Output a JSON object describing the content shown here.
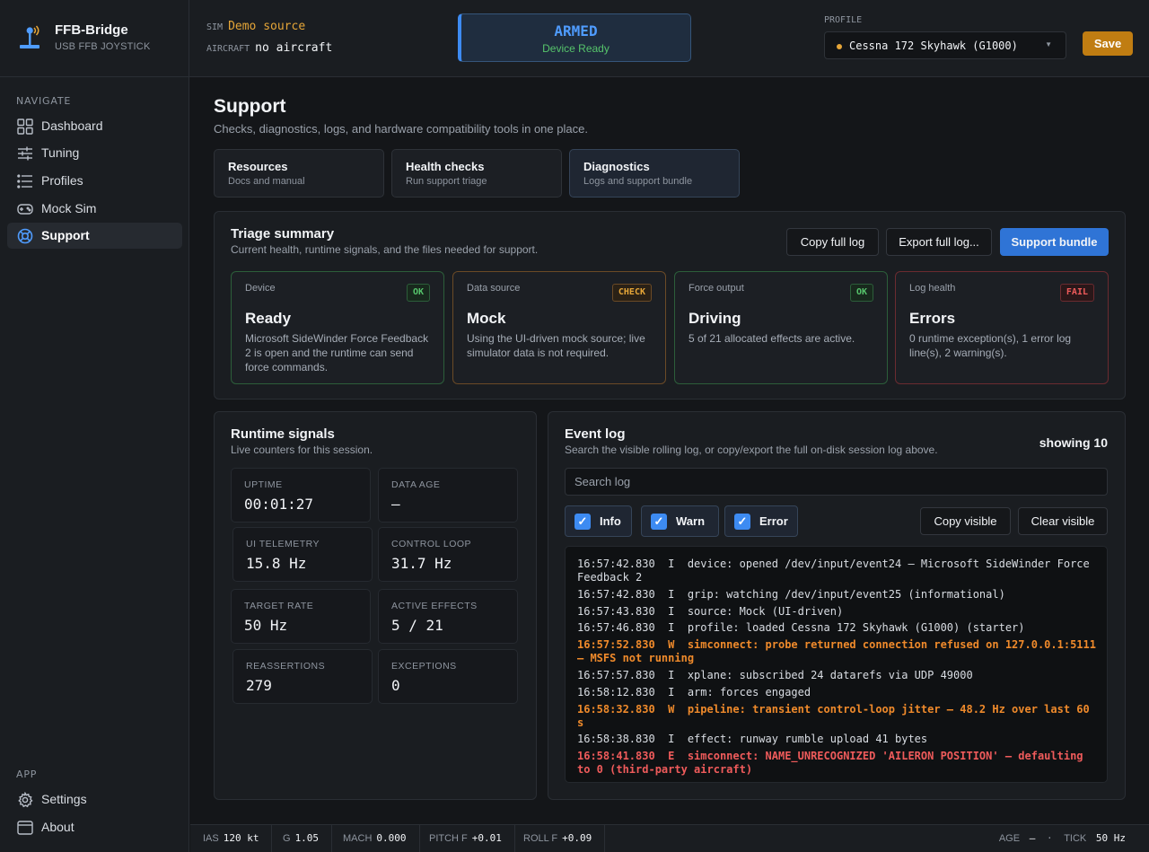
{
  "app": {
    "name": "FFB-Bridge",
    "subtitle": "USB FFB JOYSTICK"
  },
  "sim": {
    "sim_label": "SIM",
    "sim_value": "Demo source",
    "aircraft_label": "AIRCRAFT",
    "aircraft_value": "no aircraft"
  },
  "status": {
    "state": "ARMED",
    "detail": "Device Ready"
  },
  "profile": {
    "label": "PROFILE",
    "selected": "Cessna 172 Skyhawk (G1000)",
    "save_label": "Save"
  },
  "sidebar": {
    "navigate_heading": "NAVIGATE",
    "items": [
      {
        "label": "Dashboard",
        "icon": "dashboard-icon"
      },
      {
        "label": "Tuning",
        "icon": "sliders-icon"
      },
      {
        "label": "Profiles",
        "icon": "list-icon"
      },
      {
        "label": "Mock Sim",
        "icon": "gamepad-icon"
      },
      {
        "label": "Support",
        "icon": "lifebuoy-icon"
      }
    ],
    "app_heading": "APP",
    "app_items": [
      {
        "label": "Settings",
        "icon": "gear-icon"
      },
      {
        "label": "About",
        "icon": "window-icon"
      }
    ]
  },
  "page": {
    "title": "Support",
    "subtitle": "Checks, diagnostics, logs, and hardware compatibility tools in one place.",
    "tabs": [
      {
        "title": "Resources",
        "sub": "Docs and manual"
      },
      {
        "title": "Health checks",
        "sub": "Run support triage"
      },
      {
        "title": "Diagnostics",
        "sub": "Logs and support bundle"
      }
    ]
  },
  "triage": {
    "title": "Triage summary",
    "subtitle": "Current health, runtime signals, and the files needed for support.",
    "copy_label": "Copy full log",
    "export_label": "Export full log...",
    "bundle_label": "Support bundle",
    "cards": [
      {
        "label": "Device",
        "badge": "OK",
        "value": "Ready",
        "desc": "Microsoft SideWinder Force Feedback 2 is open and the runtime can send force commands."
      },
      {
        "label": "Data source",
        "badge": "CHECK",
        "value": "Mock",
        "desc": "Using the UI-driven mock source; live simulator data is not required."
      },
      {
        "label": "Force output",
        "badge": "OK",
        "value": "Driving",
        "desc": "5 of 21 allocated effects are active."
      },
      {
        "label": "Log health",
        "badge": "FAIL",
        "value": "Errors",
        "desc": "0 runtime exception(s), 1 error log line(s), 2 warning(s)."
      }
    ]
  },
  "runtime": {
    "title": "Runtime signals",
    "subtitle": "Live counters for this session.",
    "signals": [
      {
        "label": "UPTIME",
        "value": "00:01:27"
      },
      {
        "label": "DATA AGE",
        "value": "—"
      },
      {
        "label": "UI TELEMETRY",
        "value": "15.8 Hz"
      },
      {
        "label": "CONTROL LOOP",
        "value": "31.7 Hz"
      },
      {
        "label": "TARGET RATE",
        "value": "50 Hz"
      },
      {
        "label": "ACTIVE EFFECTS",
        "value": "5 / 21"
      },
      {
        "label": "REASSERTIONS",
        "value": "279"
      },
      {
        "label": "EXCEPTIONS",
        "value": "0"
      }
    ]
  },
  "eventlog": {
    "title": "Event log",
    "subtitle": "Search the visible rolling log, or copy/export the full on-disk session log above.",
    "count": "showing 10",
    "search_placeholder": "Search log",
    "filters": [
      {
        "label": "Info"
      },
      {
        "label": "Warn"
      },
      {
        "label": "Error"
      }
    ],
    "copy_visible_label": "Copy visible",
    "clear_visible_label": "Clear visible",
    "lines": [
      {
        "level": "I",
        "text": "16:57:42.830  I  device: opened /dev/input/event24 — Microsoft SideWinder Force Feedback 2"
      },
      {
        "level": "I",
        "text": "16:57:42.830  I  grip: watching /dev/input/event25 (informational)"
      },
      {
        "level": "I",
        "text": "16:57:43.830  I  source: Mock (UI-driven)"
      },
      {
        "level": "I",
        "text": "16:57:46.830  I  profile: loaded Cessna 172 Skyhawk (G1000) (starter)"
      },
      {
        "level": "W",
        "text": "16:57:52.830  W  simconnect: probe returned connection refused on 127.0.0.1:5111 — MSFS not running"
      },
      {
        "level": "I",
        "text": "16:57:57.830  I  xplane: subscribed 24 datarefs via UDP 49000"
      },
      {
        "level": "I",
        "text": "16:58:12.830  I  arm: forces engaged"
      },
      {
        "level": "W",
        "text": "16:58:32.830  W  pipeline: transient control-loop jitter — 48.2 Hz over last 60 s"
      },
      {
        "level": "I",
        "text": "16:58:38.830  I  effect: runway rumble upload 41 bytes"
      },
      {
        "level": "E",
        "text": "16:58:41.830  E  simconnect: NAME_UNRECOGNIZED 'AILERON POSITION' — defaulting to 0 (third-party aircraft)"
      }
    ]
  },
  "statusbar": {
    "items": [
      {
        "label": "IAS",
        "value": "120 kt"
      },
      {
        "label": "G",
        "value": "1.05"
      },
      {
        "label": "MACH",
        "value": "0.000"
      },
      {
        "label": "PITCH F",
        "value": "+0.01"
      },
      {
        "label": "ROLL F",
        "value": "+0.09"
      }
    ],
    "age_label": "AGE",
    "age_value": "—",
    "sep": "·",
    "tick_label": "TICK",
    "tick_value": "50 Hz"
  },
  "colors": {
    "accent": "#3d8bf2",
    "ok": "#56c46b",
    "warn": "#e6a638",
    "fail": "#ef5b5b",
    "save": "#c07d12"
  }
}
